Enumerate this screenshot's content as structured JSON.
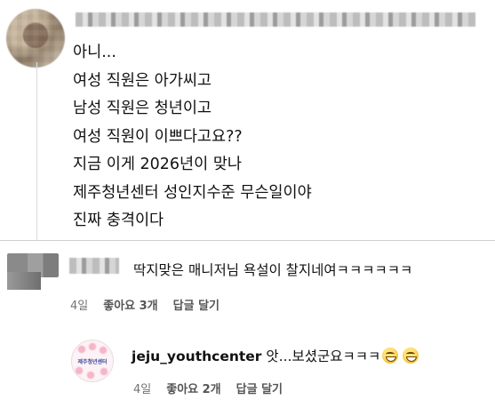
{
  "post": {
    "lines": [
      "아니...",
      "여성 직원은 아가씨고",
      "남성 직원은 청년이고",
      "여성 직원이 이쁘다고요??",
      "지금 이게 2026년이 맞나",
      "제주청년센터 성인지수준 무슨일이야",
      "진짜 충격이다"
    ]
  },
  "comment": {
    "text": "딱지맞은 매니저님 욕설이 찰지네여ㅋㅋㅋㅋㅋㅋ",
    "time": "4일",
    "likes": "좋아요 3개",
    "reply_label": "답글 달기"
  },
  "reply": {
    "username": "jeju_youthcenter",
    "text": "앗...보셨군요ㅋㅋㅋ",
    "emoji_icons": [
      "grinning-face-icon",
      "grinning-face-icon"
    ],
    "avatar_text": "제주청년센터",
    "time": "4일",
    "likes": "좋아요 2개",
    "reply_label": "답글 달기"
  }
}
